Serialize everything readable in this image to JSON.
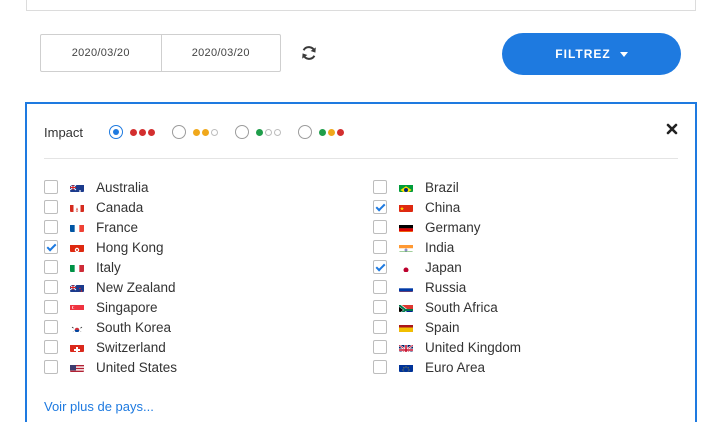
{
  "dates": {
    "start": "2020/03/20",
    "end": "2020/03/20"
  },
  "filter_button": {
    "label": "FILTREZ"
  },
  "impact": {
    "label": "Impact",
    "options": [
      {
        "dots": [
          "#d32f2f",
          "#d32f2f",
          "#d32f2f"
        ],
        "checked": true
      },
      {
        "dots": [
          "#f0a81c",
          "#f0a81c",
          "hollow"
        ],
        "checked": false
      },
      {
        "dots": [
          "#1f9e4a",
          "hollow",
          "hollow"
        ],
        "checked": false
      },
      {
        "dots": [
          "#1f9e4a",
          "#f0a81c",
          "#d32f2f"
        ],
        "checked": false
      }
    ]
  },
  "countries_left": [
    {
      "name": "Australia",
      "checked": false,
      "flag": "au"
    },
    {
      "name": "Canada",
      "checked": false,
      "flag": "ca"
    },
    {
      "name": "France",
      "checked": false,
      "flag": "fr"
    },
    {
      "name": "Hong Kong",
      "checked": true,
      "flag": "hk"
    },
    {
      "name": "Italy",
      "checked": false,
      "flag": "it"
    },
    {
      "name": "New Zealand",
      "checked": false,
      "flag": "nz"
    },
    {
      "name": "Singapore",
      "checked": false,
      "flag": "sg"
    },
    {
      "name": "South Korea",
      "checked": false,
      "flag": "kr"
    },
    {
      "name": "Switzerland",
      "checked": false,
      "flag": "ch"
    },
    {
      "name": "United States",
      "checked": false,
      "flag": "us"
    }
  ],
  "countries_right": [
    {
      "name": "Brazil",
      "checked": false,
      "flag": "br"
    },
    {
      "name": "China",
      "checked": true,
      "flag": "cn"
    },
    {
      "name": "Germany",
      "checked": false,
      "flag": "de"
    },
    {
      "name": "India",
      "checked": false,
      "flag": "in"
    },
    {
      "name": "Japan",
      "checked": true,
      "flag": "jp"
    },
    {
      "name": "Russia",
      "checked": false,
      "flag": "ru"
    },
    {
      "name": "South Africa",
      "checked": false,
      "flag": "za"
    },
    {
      "name": "Spain",
      "checked": false,
      "flag": "es"
    },
    {
      "name": "United Kingdom",
      "checked": false,
      "flag": "gb"
    },
    {
      "name": "Euro Area",
      "checked": false,
      "flag": "eu"
    }
  ],
  "more_link": "Voir plus de pays...",
  "colors": {
    "accent": "#1e7ae0",
    "high": "#d32f2f",
    "medium": "#f0a81c",
    "low": "#1f9e4a"
  }
}
